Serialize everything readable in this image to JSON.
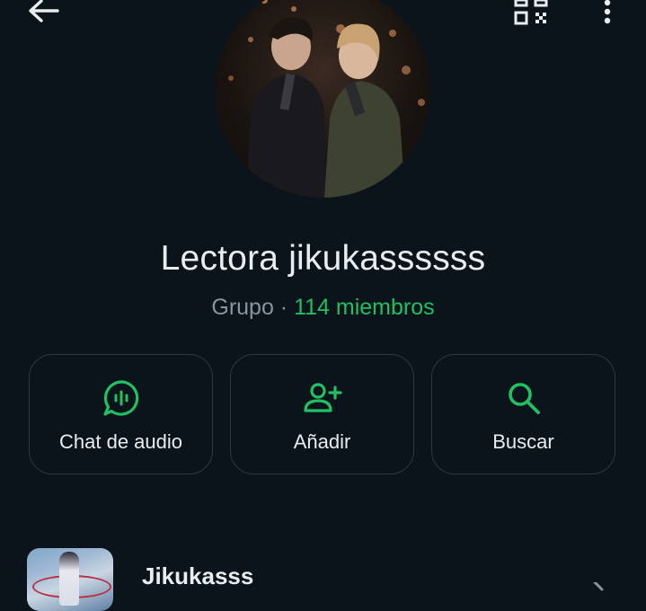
{
  "header": {
    "back_icon": "arrow-left-icon",
    "qr_icon": "qr-code-icon",
    "more_icon": "more-vertical-icon"
  },
  "profile": {
    "name": "Lectora jikukassssss",
    "type_label": "Grupo",
    "separator": " · ",
    "members": "114 miembros"
  },
  "actions": [
    {
      "label": "Chat de audio",
      "icon": "audio-chat-icon"
    },
    {
      "label": "Añadir",
      "icon": "add-person-icon"
    },
    {
      "label": "Buscar",
      "icon": "search-icon"
    }
  ],
  "community": {
    "name": "Jikukasss"
  },
  "colors": {
    "background": "#0b141a",
    "accent": "#21c063",
    "text_primary": "#e9edef",
    "text_secondary": "#8696a0",
    "border": "#2a3942"
  }
}
